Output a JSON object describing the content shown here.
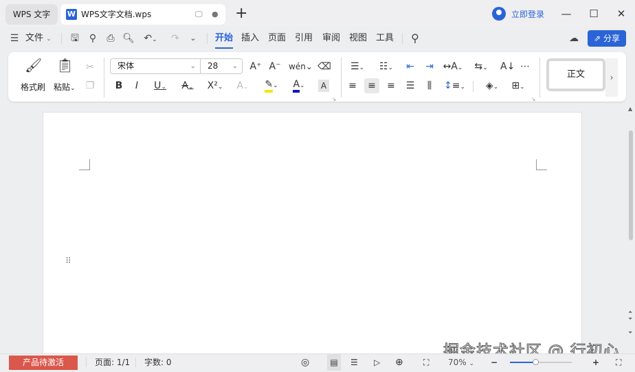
{
  "titlebar": {
    "app_tab": "WPS 文字",
    "doc_tab": "WPS文字文档.wps",
    "logo_letter": "W",
    "login": "立即登录"
  },
  "menubar": {
    "file": "文件",
    "tabs": [
      "开始",
      "插入",
      "页面",
      "引用",
      "审阅",
      "视图",
      "工具"
    ],
    "active_tab": "开始",
    "share": "分享"
  },
  "ribbon": {
    "format_painter": "格式刷",
    "paste": "粘贴",
    "font_name": "宋体",
    "font_size": "28",
    "style_normal": "正文"
  },
  "status": {
    "activate": "产品待激活",
    "page": "页面: 1/1",
    "words": "字数: 0",
    "zoom": "70%"
  },
  "zoom_level_percent": 70,
  "watermark": "掘金技术社区 @ 行初心",
  "colors": {
    "accent": "#2b64d6",
    "highlight": "#f5e60a",
    "font_color": "#0a14c8",
    "activate_bg": "#d9574b"
  }
}
